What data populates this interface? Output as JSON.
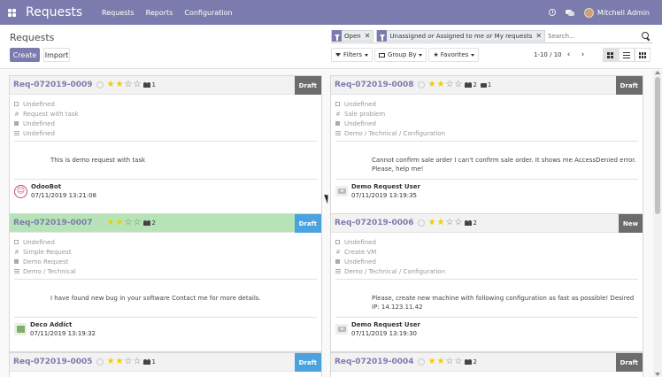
{
  "navbar": {
    "title": "Requests",
    "menu": [
      "Requests",
      "Reports",
      "Configuration"
    ],
    "user": "Mitchell Admin"
  },
  "control": {
    "title": "Requests",
    "create": "Create",
    "import": "Import",
    "facets": [
      {
        "label": "Open"
      },
      {
        "label_a": "Unassigned",
        "or": "or",
        "label_b": "Assigned to me",
        "or2": "or",
        "label_c": "My requests"
      }
    ],
    "search_placeholder": "Search...",
    "filters": "Filters",
    "group_by": "Group By",
    "favorites": "Favorites",
    "pager": "1-10 / 10"
  },
  "cards": [
    {
      "ref": "Req-072019-0009",
      "stars": 2,
      "followers": "1",
      "attachments": "",
      "stage": "Draft",
      "stage_style": "draft",
      "fields": [
        "Undefined",
        "Request with task",
        "Undefined",
        "Undefined"
      ],
      "description": "This is demo request with task",
      "author": "OdooBot",
      "date": "07/11/2019 13:21:08",
      "avatar": "bot"
    },
    {
      "ref": "Req-072019-0008",
      "stars": 2,
      "followers": "2",
      "attachments": "1",
      "stage": "Draft",
      "stage_style": "draft",
      "fields": [
        "Undefined",
        "Sale problem",
        "Undefined",
        "Demo / Technical / Configuration"
      ],
      "description": "Cannot confirm sale order I can't confirm sale order. It shows me AccessDenied error. Please, help me!",
      "author": "Demo Request User",
      "date": "07/11/2019 13:19:35",
      "avatar": "cam"
    },
    {
      "ref": "Req-072019-0007",
      "stars": 2,
      "followers": "2",
      "attachments": "",
      "stage": "Draft",
      "stage_style": "blue",
      "fields": [
        "Undefined",
        "Simple Request",
        "Demo Request",
        "Demo / Technical"
      ],
      "description": "I have found new bug in your software Contact me for more details.",
      "author": "Deco Addict",
      "date": "07/11/2019 13:19:32",
      "avatar": "deco"
    },
    {
      "ref": "Req-072019-0006",
      "stars": 2,
      "followers": "2",
      "attachments": "",
      "stage": "New",
      "stage_style": "new",
      "fields": [
        "Undefined",
        "Create VM",
        "Undefined",
        "Demo / Technical / Configuration"
      ],
      "description": "Please, create new machine with following configuration as fast as possible! Desired IP: 14.123.11.42",
      "author": "Demo Request User",
      "date": "07/11/2019 13:19:30",
      "avatar": "cam"
    },
    {
      "ref": "Req-072019-0005",
      "stars": 2,
      "followers": "1",
      "attachments": "",
      "stage": "Draft",
      "stage_style": "blue",
      "fields": [],
      "description": "",
      "author": "",
      "date": "",
      "avatar": ""
    },
    {
      "ref": "Req-072019-0004",
      "stars": 2,
      "followers": "2",
      "attachments": "",
      "stage": "Draft",
      "stage_style": "draft",
      "fields": [],
      "description": "",
      "author": "",
      "date": "",
      "avatar": ""
    }
  ]
}
